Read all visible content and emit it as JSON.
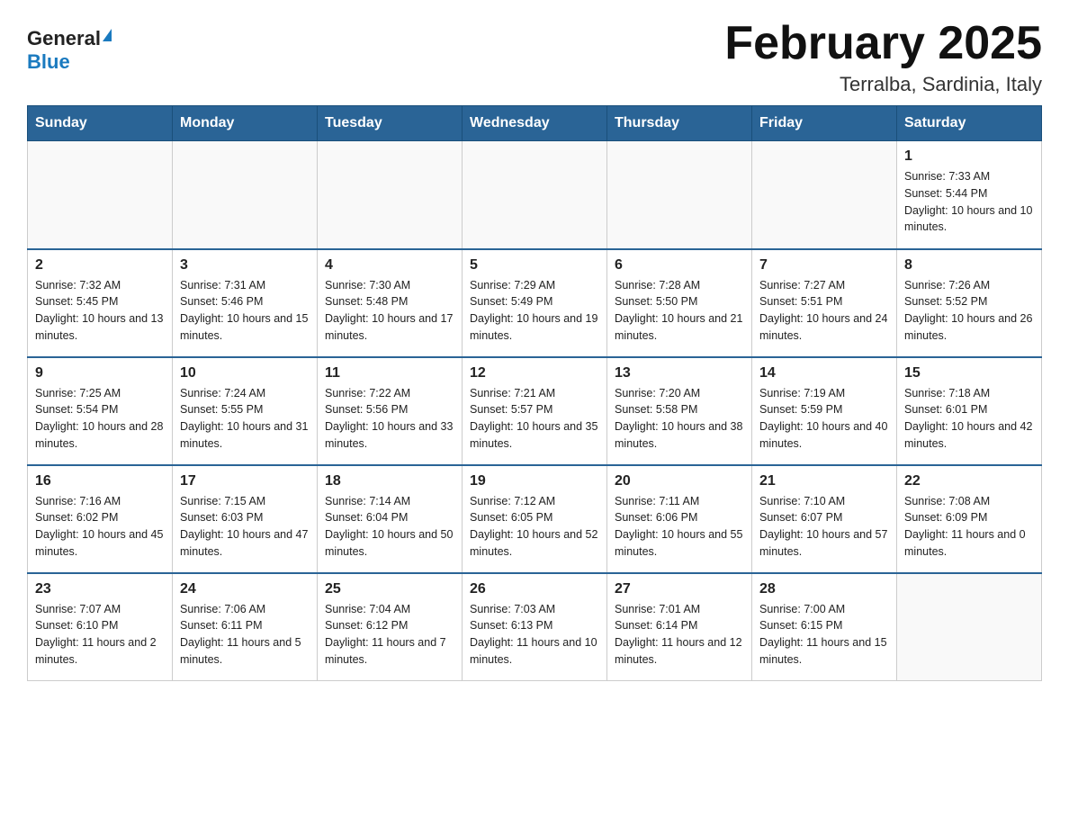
{
  "header": {
    "logo_general": "General",
    "logo_blue": "Blue",
    "title": "February 2025",
    "subtitle": "Terralba, Sardinia, Italy"
  },
  "days_of_week": [
    "Sunday",
    "Monday",
    "Tuesday",
    "Wednesday",
    "Thursday",
    "Friday",
    "Saturday"
  ],
  "weeks": [
    [
      {
        "day": "",
        "info": ""
      },
      {
        "day": "",
        "info": ""
      },
      {
        "day": "",
        "info": ""
      },
      {
        "day": "",
        "info": ""
      },
      {
        "day": "",
        "info": ""
      },
      {
        "day": "",
        "info": ""
      },
      {
        "day": "1",
        "info": "Sunrise: 7:33 AM\nSunset: 5:44 PM\nDaylight: 10 hours and 10 minutes."
      }
    ],
    [
      {
        "day": "2",
        "info": "Sunrise: 7:32 AM\nSunset: 5:45 PM\nDaylight: 10 hours and 13 minutes."
      },
      {
        "day": "3",
        "info": "Sunrise: 7:31 AM\nSunset: 5:46 PM\nDaylight: 10 hours and 15 minutes."
      },
      {
        "day": "4",
        "info": "Sunrise: 7:30 AM\nSunset: 5:48 PM\nDaylight: 10 hours and 17 minutes."
      },
      {
        "day": "5",
        "info": "Sunrise: 7:29 AM\nSunset: 5:49 PM\nDaylight: 10 hours and 19 minutes."
      },
      {
        "day": "6",
        "info": "Sunrise: 7:28 AM\nSunset: 5:50 PM\nDaylight: 10 hours and 21 minutes."
      },
      {
        "day": "7",
        "info": "Sunrise: 7:27 AM\nSunset: 5:51 PM\nDaylight: 10 hours and 24 minutes."
      },
      {
        "day": "8",
        "info": "Sunrise: 7:26 AM\nSunset: 5:52 PM\nDaylight: 10 hours and 26 minutes."
      }
    ],
    [
      {
        "day": "9",
        "info": "Sunrise: 7:25 AM\nSunset: 5:54 PM\nDaylight: 10 hours and 28 minutes."
      },
      {
        "day": "10",
        "info": "Sunrise: 7:24 AM\nSunset: 5:55 PM\nDaylight: 10 hours and 31 minutes."
      },
      {
        "day": "11",
        "info": "Sunrise: 7:22 AM\nSunset: 5:56 PM\nDaylight: 10 hours and 33 minutes."
      },
      {
        "day": "12",
        "info": "Sunrise: 7:21 AM\nSunset: 5:57 PM\nDaylight: 10 hours and 35 minutes."
      },
      {
        "day": "13",
        "info": "Sunrise: 7:20 AM\nSunset: 5:58 PM\nDaylight: 10 hours and 38 minutes."
      },
      {
        "day": "14",
        "info": "Sunrise: 7:19 AM\nSunset: 5:59 PM\nDaylight: 10 hours and 40 minutes."
      },
      {
        "day": "15",
        "info": "Sunrise: 7:18 AM\nSunset: 6:01 PM\nDaylight: 10 hours and 42 minutes."
      }
    ],
    [
      {
        "day": "16",
        "info": "Sunrise: 7:16 AM\nSunset: 6:02 PM\nDaylight: 10 hours and 45 minutes."
      },
      {
        "day": "17",
        "info": "Sunrise: 7:15 AM\nSunset: 6:03 PM\nDaylight: 10 hours and 47 minutes."
      },
      {
        "day": "18",
        "info": "Sunrise: 7:14 AM\nSunset: 6:04 PM\nDaylight: 10 hours and 50 minutes."
      },
      {
        "day": "19",
        "info": "Sunrise: 7:12 AM\nSunset: 6:05 PM\nDaylight: 10 hours and 52 minutes."
      },
      {
        "day": "20",
        "info": "Sunrise: 7:11 AM\nSunset: 6:06 PM\nDaylight: 10 hours and 55 minutes."
      },
      {
        "day": "21",
        "info": "Sunrise: 7:10 AM\nSunset: 6:07 PM\nDaylight: 10 hours and 57 minutes."
      },
      {
        "day": "22",
        "info": "Sunrise: 7:08 AM\nSunset: 6:09 PM\nDaylight: 11 hours and 0 minutes."
      }
    ],
    [
      {
        "day": "23",
        "info": "Sunrise: 7:07 AM\nSunset: 6:10 PM\nDaylight: 11 hours and 2 minutes."
      },
      {
        "day": "24",
        "info": "Sunrise: 7:06 AM\nSunset: 6:11 PM\nDaylight: 11 hours and 5 minutes."
      },
      {
        "day": "25",
        "info": "Sunrise: 7:04 AM\nSunset: 6:12 PM\nDaylight: 11 hours and 7 minutes."
      },
      {
        "day": "26",
        "info": "Sunrise: 7:03 AM\nSunset: 6:13 PM\nDaylight: 11 hours and 10 minutes."
      },
      {
        "day": "27",
        "info": "Sunrise: 7:01 AM\nSunset: 6:14 PM\nDaylight: 11 hours and 12 minutes."
      },
      {
        "day": "28",
        "info": "Sunrise: 7:00 AM\nSunset: 6:15 PM\nDaylight: 11 hours and 15 minutes."
      },
      {
        "day": "",
        "info": ""
      }
    ]
  ]
}
